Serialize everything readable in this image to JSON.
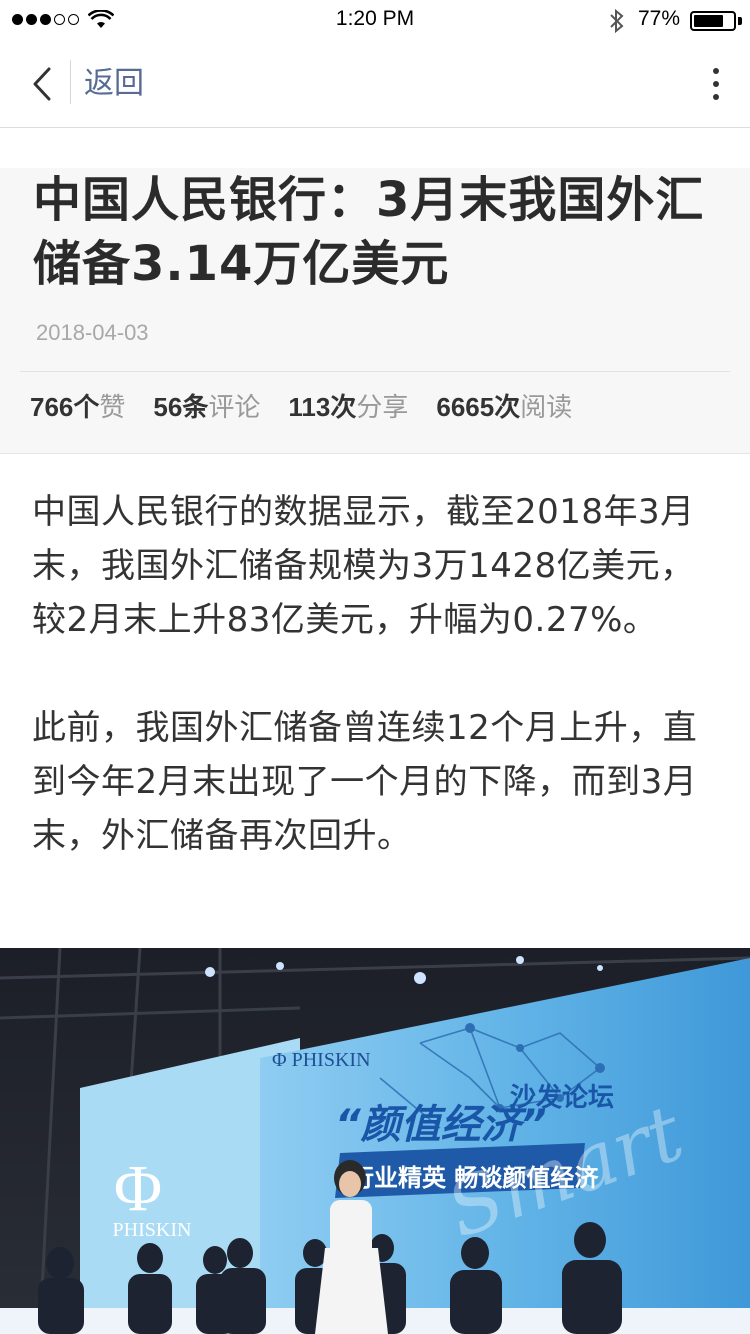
{
  "status_bar": {
    "time": "1:20 PM",
    "battery_percent": "77%",
    "battery_level": 0.77,
    "signal_bars_filled": 3,
    "signal_bars_total": 5
  },
  "nav": {
    "back_label": "返回",
    "icons": [
      "chevron-left-icon",
      "more-vertical-icon"
    ]
  },
  "article": {
    "title": "中国人民银行：3月末我国外汇储备3.14万亿美元",
    "date": "2018-04-03",
    "stats": [
      {
        "num": "766",
        "unit": "个",
        "label": "赞"
      },
      {
        "num": "56",
        "unit": "条",
        "label": "评论"
      },
      {
        "num": "113",
        "unit": "次",
        "label": "分享"
      },
      {
        "num": "6665",
        "unit": "次",
        "label": "阅读"
      }
    ],
    "paragraphs": [
      "中国人民银行的数据显示，截至2018年3月末，我国外汇储备规模为3万1428亿美元，较2月末上升83亿美元，升幅为0.27%。",
      "此前，我国外汇储备曾连续12个月上升，直到今年2月末出现了一个月的下降，而到3月末，外汇储备再次回升。"
    ]
  },
  "photo": {
    "brand": "Φ PHISKIN",
    "banner_title": "“颜值经济”",
    "banner_sub": "沙发论坛",
    "banner_slogan": "行业精英  畅谈颜值经济",
    "side_logo_symbol": "Φ",
    "side_logo_text": "PHISKIN",
    "script_text": "Smart"
  },
  "colors": {
    "link": "#576b95",
    "header_bg": "#f7f7f7",
    "stage_blue": "#5fb2e6"
  }
}
